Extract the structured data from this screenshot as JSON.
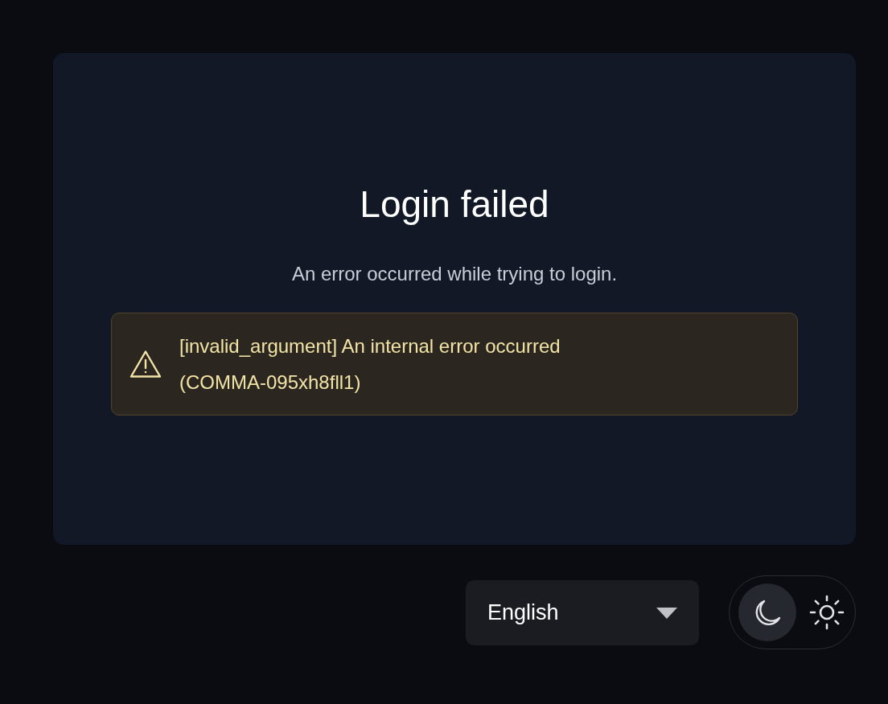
{
  "card": {
    "title": "Login failed",
    "message": "An error occurred while trying to login.",
    "alert": {
      "kind": "warning",
      "text": "[invalid_argument] An internal error occurred (COMMA-095xh8fll1)"
    }
  },
  "language_select": {
    "value": "English"
  },
  "theme_toggle": {
    "options": [
      {
        "kind": "dark",
        "selected": true
      },
      {
        "kind": "light",
        "selected": false
      }
    ]
  }
}
